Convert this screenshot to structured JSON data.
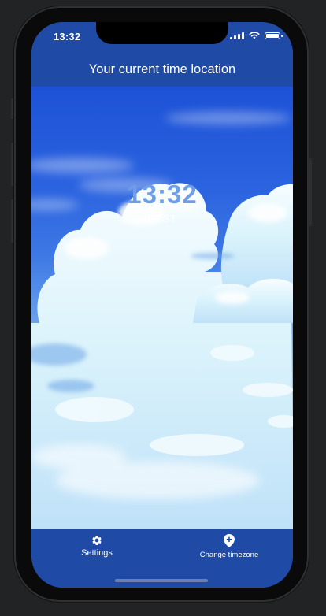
{
  "status_bar": {
    "time": "13:32",
    "battery_level": 1.0
  },
  "header": {
    "title": "Your current time location"
  },
  "clock": {
    "time": "13:32",
    "timezone": "CEST"
  },
  "tab_bar": {
    "items": [
      {
        "label": "Settings",
        "icon": "gear-icon"
      },
      {
        "label": "Change timezone",
        "icon": "location-pin-icon"
      }
    ]
  },
  "colors": {
    "bar_blue": "#1f4aa6",
    "sky_top": "#1d52d6",
    "clock_text": "#6f9ee8"
  }
}
